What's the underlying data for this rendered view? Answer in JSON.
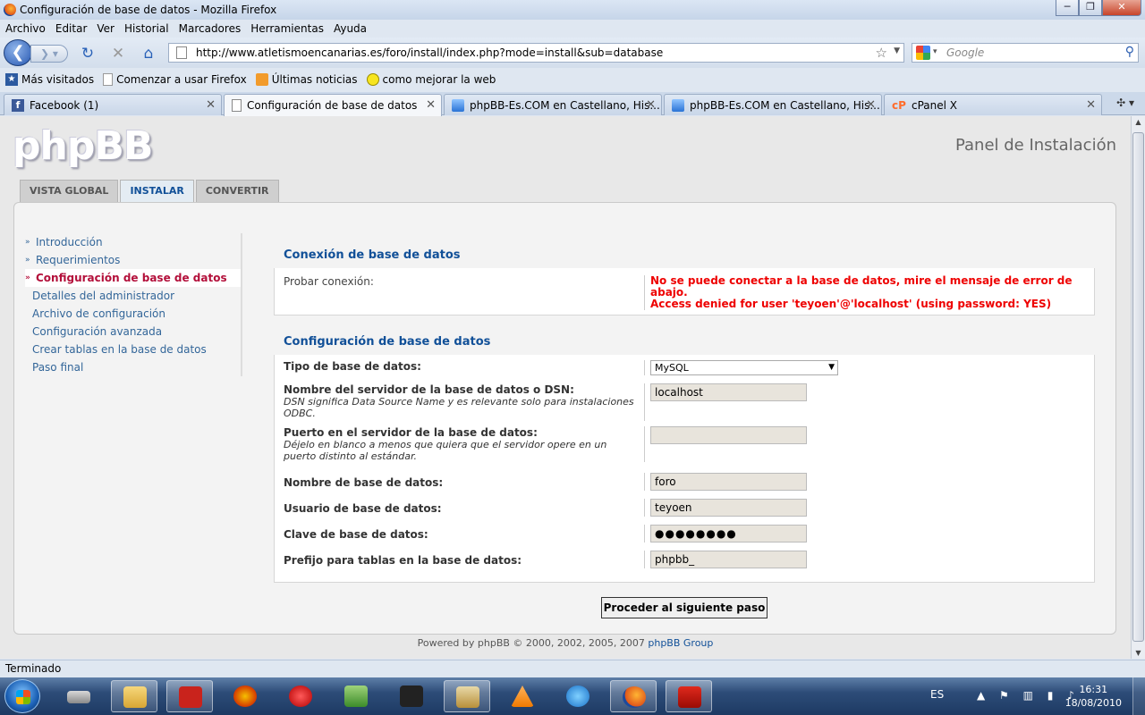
{
  "window": {
    "title": "Configuración de base de datos - Mozilla Firefox",
    "minimize": "─",
    "maximize": "❐",
    "close": "✕"
  },
  "menu": [
    "Archivo",
    "Editar",
    "Ver",
    "Historial",
    "Marcadores",
    "Herramientas",
    "Ayuda"
  ],
  "nav": {
    "url": "http://www.atletismoencanarias.es/foro/install/index.php?mode=install&sub=database",
    "search_placeholder": "Google"
  },
  "bookmarks": [
    {
      "label": "Más visitados",
      "icon": "star-icon"
    },
    {
      "label": "Comenzar a usar Firefox",
      "icon": "page-icon"
    },
    {
      "label": "Últimas noticias",
      "icon": "rss-icon"
    },
    {
      "label": "como mejorar la web",
      "icon": "smiley-icon"
    }
  ],
  "tabs": [
    {
      "label": "Facebook (1)",
      "icon": "facebook-icon",
      "active": false
    },
    {
      "label": "Configuración de base de datos",
      "icon": "page-icon",
      "active": true
    },
    {
      "label": "phpBB-Es.COM en Castellano, His...",
      "icon": "phpbb-icon",
      "active": false
    },
    {
      "label": "phpBB-Es.COM en Castellano, His...",
      "icon": "phpbb-icon",
      "active": false
    },
    {
      "label": "cPanel X",
      "icon": "cpanel-icon",
      "active": false
    }
  ],
  "page": {
    "logo": "phpBB",
    "panel_title": "Panel de Instalación",
    "tabs": [
      "VISTA GLOBAL",
      "INSTALAR",
      "CONVERTIR"
    ],
    "active_tab": "INSTALAR",
    "menu": [
      {
        "label": "Introducción",
        "state": "done"
      },
      {
        "label": "Requerimientos",
        "state": "done"
      },
      {
        "label": "Configuración de base de datos",
        "state": "current"
      },
      {
        "label": "Detalles del administrador",
        "state": "todo"
      },
      {
        "label": "Archivo de configuración",
        "state": "todo"
      },
      {
        "label": "Configuración avanzada",
        "state": "todo"
      },
      {
        "label": "Crear tablas en la base de datos",
        "state": "todo"
      },
      {
        "label": "Paso final",
        "state": "todo"
      }
    ],
    "connection": {
      "legend": "Conexión de base de datos",
      "label": "Probar conexión:",
      "error_line1": "No se puede conectar a la base de datos, mire el mensaje de error de abajo.",
      "error_line2": "Access denied for user 'teyoen'@'localhost' (using password: YES)"
    },
    "config": {
      "legend": "Configuración de base de datos",
      "dbtype_label": "Tipo de base de datos:",
      "dbtype_value": "MySQL",
      "host_label": "Nombre del servidor de la base de datos o DSN:",
      "host_desc": "DSN significa Data Source Name y es relevante solo para instalaciones ODBC.",
      "host_value": "localhost",
      "port_label": "Puerto en el servidor de la base de datos:",
      "port_desc": "Déjelo en blanco a menos que quiera que el servidor opere en un puerto distinto al estándar.",
      "port_value": "",
      "dbname_label": "Nombre de base de datos:",
      "dbname_value": "foro",
      "user_label": "Usuario de base de datos:",
      "user_value": "teyoen",
      "pass_label": "Clave de base de datos:",
      "pass_value": "●●●●●●●●",
      "prefix_label": "Prefijo para tablas en la base de datos:",
      "prefix_value": "phpbb_"
    },
    "submit": "Proceder al siguiente paso",
    "footer_text": "Powered by phpBB © 2000, 2002, 2005, 2007",
    "footer_link": "phpBB Group"
  },
  "status": "Terminado",
  "taskbar": {
    "lang": "ES",
    "time": "16:31",
    "date": "18/08/2010",
    "apps": [
      "drive-icon",
      "explorer-icon",
      "filezilla-icon",
      "poker-chip-icon",
      "pokerstars-icon",
      "network-icon",
      "fulltilt-icon",
      "window-icon",
      "vlc-icon",
      "ie-icon",
      "firefox-icon",
      "acrobat-icon"
    ]
  }
}
